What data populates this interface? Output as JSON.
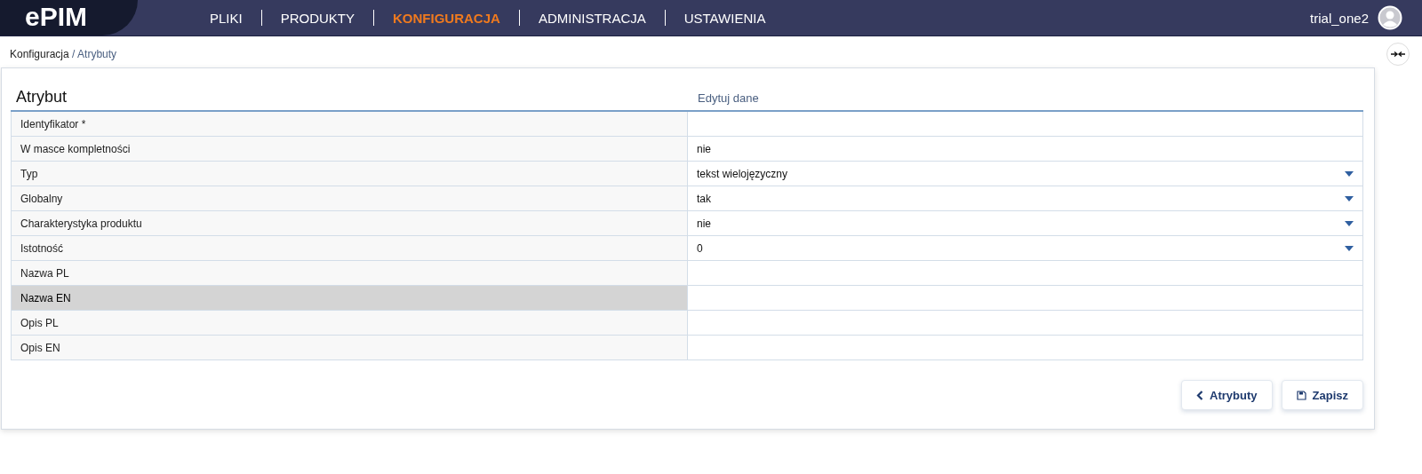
{
  "header": {
    "logo": "ePIM",
    "nav": [
      {
        "label": "PLIKI",
        "selected": false
      },
      {
        "label": "PRODUKTY",
        "selected": false
      },
      {
        "label": "KONFIGURACJA",
        "selected": true
      },
      {
        "label": "ADMINISTRACJA",
        "selected": false
      },
      {
        "label": "USTAWIENIA",
        "selected": false
      }
    ],
    "user": "trial_one2"
  },
  "breadcrumb": {
    "parent": "Konfiguracja",
    "separator": "/",
    "current": "Atrybuty"
  },
  "form": {
    "title": "Atrybut",
    "column_2": "Edytuj dane",
    "rows": [
      {
        "label": "Identyfikator *",
        "value": "",
        "kind": "text",
        "highlighted": false
      },
      {
        "label": "W masce kompletności",
        "value": "nie",
        "kind": "text",
        "highlighted": false
      },
      {
        "label": "Typ",
        "value": "tekst wielojęzyczny",
        "kind": "select",
        "highlighted": false
      },
      {
        "label": "Globalny",
        "value": "tak",
        "kind": "select",
        "highlighted": false
      },
      {
        "label": "Charakterystyka produktu",
        "value": "nie",
        "kind": "select",
        "highlighted": false
      },
      {
        "label": "Istotność",
        "value": "0",
        "kind": "select",
        "highlighted": false
      },
      {
        "label": "Nazwa PL",
        "value": "",
        "kind": "text",
        "highlighted": false
      },
      {
        "label": "Nazwa EN",
        "value": "",
        "kind": "text",
        "highlighted": true
      },
      {
        "label": "Opis PL",
        "value": "",
        "kind": "text",
        "highlighted": false
      },
      {
        "label": "Opis EN",
        "value": "",
        "kind": "text",
        "highlighted": false
      }
    ]
  },
  "buttons": [
    {
      "label": "Atrybuty",
      "kind": "back"
    },
    {
      "label": "Zapisz",
      "kind": "save"
    }
  ]
}
